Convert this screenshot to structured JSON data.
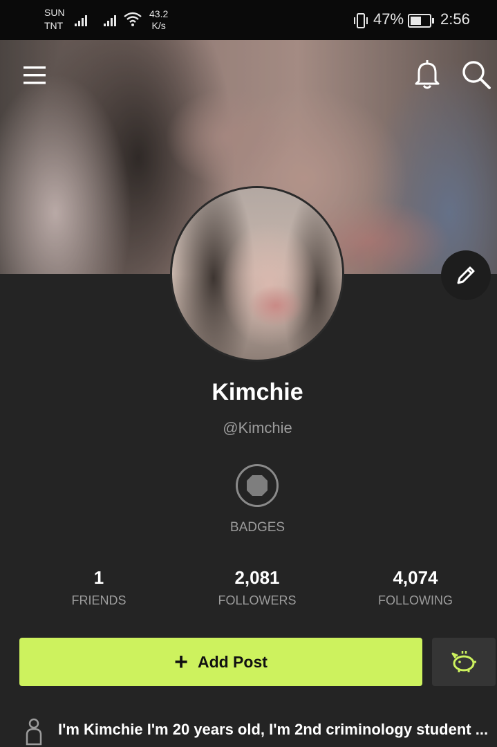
{
  "status_bar": {
    "carrier_1": "SUN",
    "carrier_2": "TNT",
    "speed_value": "43.2",
    "speed_unit": "K/s",
    "battery": "47%",
    "time": "2:56"
  },
  "profile": {
    "name": "Kimchie",
    "handle": "@Kimchie",
    "badges_label": "BADGES",
    "bio": "I'm Kimchie I'm 20 years old, I'm 2nd criminology student ..."
  },
  "stats": [
    {
      "value": "1",
      "label": "FRIENDS"
    },
    {
      "value": "2,081",
      "label": "FOLLOWERS"
    },
    {
      "value": "4,074",
      "label": "FOLLOWING"
    }
  ],
  "actions": {
    "add_post_label": "Add Post",
    "add_post_icon": "+"
  },
  "icons": {
    "menu": "hamburger-menu-icon",
    "notifications": "bell-icon",
    "search": "search-icon",
    "edit": "pencil-icon",
    "badge": "octagon-badge-icon",
    "piggy": "piggy-bank-icon",
    "bio": "person-icon"
  },
  "colors": {
    "accent": "#cdf25e",
    "background": "#242424",
    "muted_text": "#9c9c9c"
  }
}
